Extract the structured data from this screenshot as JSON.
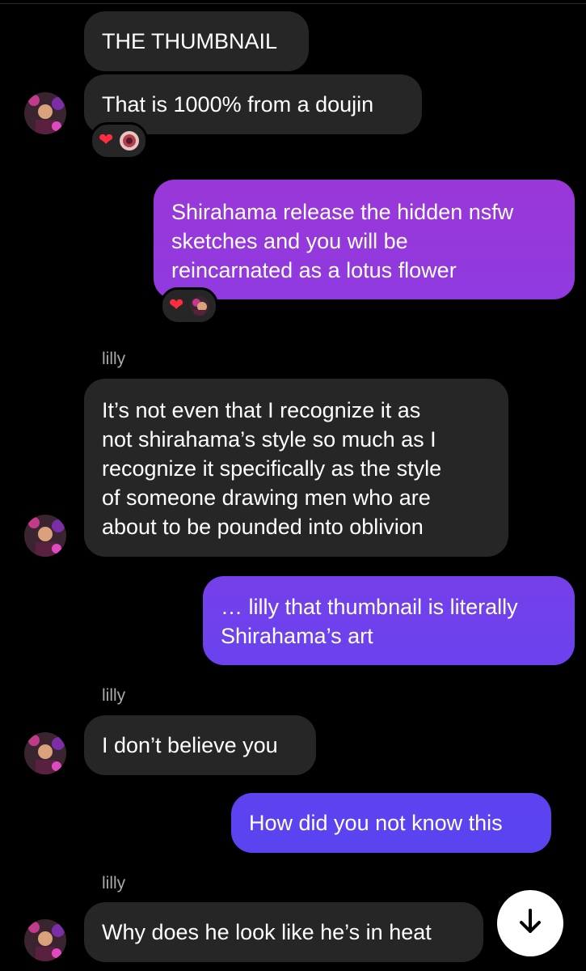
{
  "colors": {
    "background": "#000000",
    "received_bubble": "#262626",
    "sent_bubble_gradient_top": "#9a37d8",
    "sent_bubble_gradient_bottom": "#5a3ff0",
    "sender_name": "#a8a8a8",
    "heart": "#ff2d40"
  },
  "messages": [
    {
      "direction": "received",
      "text": "THE THUMBNAIL"
    },
    {
      "direction": "received",
      "text": "That is 1000% from a doujin",
      "reactions": [
        "red-heart",
        "reactor-avatar"
      ]
    },
    {
      "direction": "sent",
      "text": "Shirahama release the hidden nsfw\nsketches and you will be\nreincarnated as a lotus flower",
      "reactions": [
        "red-heart",
        "reactor-avatar"
      ]
    },
    {
      "direction": "received",
      "sender": "lilly",
      "text": "It’s not even that I recognize it as\nnot shirahama’s style so much as I\nrecognize it specifically as the style\nof someone drawing men who are\nabout to be pounded into oblivion"
    },
    {
      "direction": "sent",
      "text": "… lilly that thumbnail is literally\nShirahama’s art"
    },
    {
      "direction": "received",
      "sender": "lilly",
      "text": "I don’t believe you"
    },
    {
      "direction": "sent",
      "text": "How did you not know this"
    },
    {
      "direction": "received",
      "sender": "lilly",
      "text": "Why does he look like he’s in heat"
    }
  ],
  "scroll_button": {
    "icon": "arrow-down-icon"
  }
}
